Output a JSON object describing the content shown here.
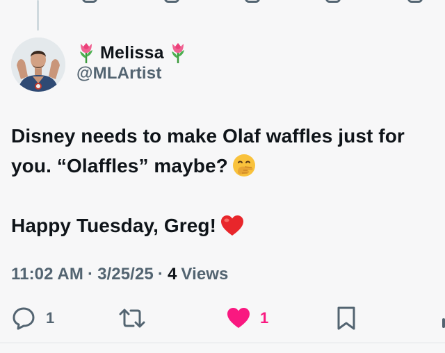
{
  "author": {
    "display_name": "Melissa",
    "name_emoji": "tulip-emoji",
    "handle": "@MLArtist"
  },
  "tweet": {
    "paragraph1": "Disney needs to make Olaf waffles just for you. “Olaffles” maybe?",
    "paragraph1_emoji": "face-with-hand-over-mouth-emoji",
    "paragraph2": "Happy Tuesday, Greg!",
    "paragraph2_emoji": "red-heart-emoji"
  },
  "meta": {
    "time": "11:02 AM",
    "separator": "·",
    "date": "3/25/25",
    "views_count": "4",
    "views_label": "Views"
  },
  "actions": {
    "reply_count": "1",
    "repost_count": "",
    "like_count": "1",
    "liked": true
  },
  "colors": {
    "text": "#0f1419",
    "secondary": "#536471",
    "like": "#f91880",
    "background": "#f7f7f8"
  }
}
